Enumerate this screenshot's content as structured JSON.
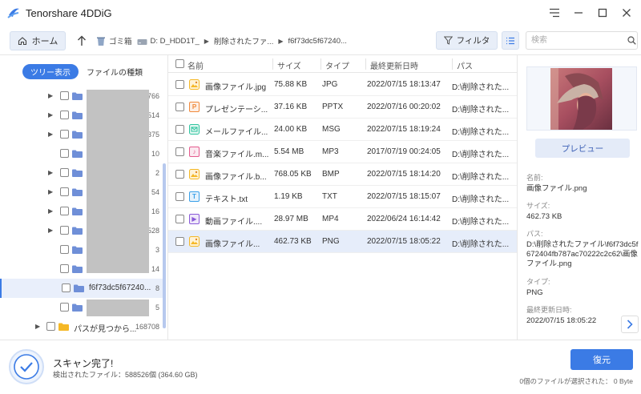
{
  "app": {
    "title": "Tenorshare 4DDiG",
    "brand_color": "#3b7be5"
  },
  "toolbar": {
    "home_label": "ホーム",
    "breadcrumbs": [
      "ゴミ箱",
      "D: D_HDD1T_",
      "削除されたファ...",
      "f6f73dc5f67240..."
    ],
    "filter_label": "フィルタ",
    "search_placeholder": "検索"
  },
  "left_panel": {
    "tabs": [
      "ツリー表示",
      "ファイルの種類"
    ],
    "tree": [
      {
        "count": "766"
      },
      {
        "count": "514"
      },
      {
        "count": "375"
      },
      {
        "count": "10"
      },
      {
        "count": "2"
      },
      {
        "count": "54"
      },
      {
        "count": "16"
      },
      {
        "count": "528"
      },
      {
        "count": "3"
      },
      {
        "count": "14"
      },
      {
        "name": "f6f73dc5f67240...",
        "count": "8"
      },
      {
        "count": "5"
      },
      {
        "name": "パスが見つから...",
        "count": "168708"
      }
    ]
  },
  "file_list": {
    "headers": [
      "名前",
      "サイズ",
      "タイプ",
      "最終更新日時",
      "パス"
    ],
    "rows": [
      {
        "name": "画像ファイル.jpg",
        "size": "75.88 KB",
        "type": "JPG",
        "modified": "2022/07/15 18:13:47",
        "path": "D:\\削除された...",
        "icon": "image-icon"
      },
      {
        "name": "プレゼンテーシ...",
        "size": "37.16 KB",
        "type": "PPTX",
        "modified": "2022/07/16 00:20:02",
        "path": "D:\\削除された...",
        "icon": "presentation-icon",
        "glyph": "P"
      },
      {
        "name": "メールファイル...",
        "size": "24.00 KB",
        "type": "MSG",
        "modified": "2022/07/15 18:19:24",
        "path": "D:\\削除された...",
        "icon": "mail-icon"
      },
      {
        "name": "音楽ファイル.m...",
        "size": "5.54 MB",
        "type": "MP3",
        "modified": "2017/07/19 00:24:05",
        "path": "D:\\削除された...",
        "icon": "music-icon",
        "glyph": "♪"
      },
      {
        "name": "画像ファイル.b...",
        "size": "768.05 KB",
        "type": "BMP",
        "modified": "2022/07/15 18:14:20",
        "path": "D:\\削除された...",
        "icon": "image-icon"
      },
      {
        "name": "テキスト.txt",
        "size": "1.19 KB",
        "type": "TXT",
        "modified": "2022/07/15 18:15:07",
        "path": "D:\\削除された...",
        "icon": "text-icon",
        "glyph": "T"
      },
      {
        "name": "動画ファイル....",
        "size": "28.97 MB",
        "type": "MP4",
        "modified": "2022/06/24 16:14:42",
        "path": "D:\\削除された...",
        "icon": "video-icon",
        "glyph": "▶"
      },
      {
        "name": "画像ファイル...",
        "size": "462.73 KB",
        "type": "PNG",
        "modified": "2022/07/15 18:05:22",
        "path": "D:\\削除された...",
        "icon": "image-icon"
      }
    ]
  },
  "preview": {
    "button_label": "プレビュー",
    "name_label": "名前:",
    "name_value": "画像ファイル.png",
    "size_label": "サイズ:",
    "size_value": "462.73 KB",
    "path_label": "パス:",
    "path_value": "D:\\削除されたファイル\\f6f73dc5f672404fb787ac70222c2c62\\画像ファイル.png",
    "type_label": "タイプ:",
    "type_value": "PNG",
    "modified_label": "最終更新日時:",
    "modified_value": "2022/07/15 18:05:22"
  },
  "footer": {
    "scan_title": "スキャン完了!",
    "scan_subtitle": "検出されたファイル：588526個 (364.60 GB)",
    "restore_label": "復元",
    "selection_status": "0個のファイルが選択された：  0 Byte"
  }
}
